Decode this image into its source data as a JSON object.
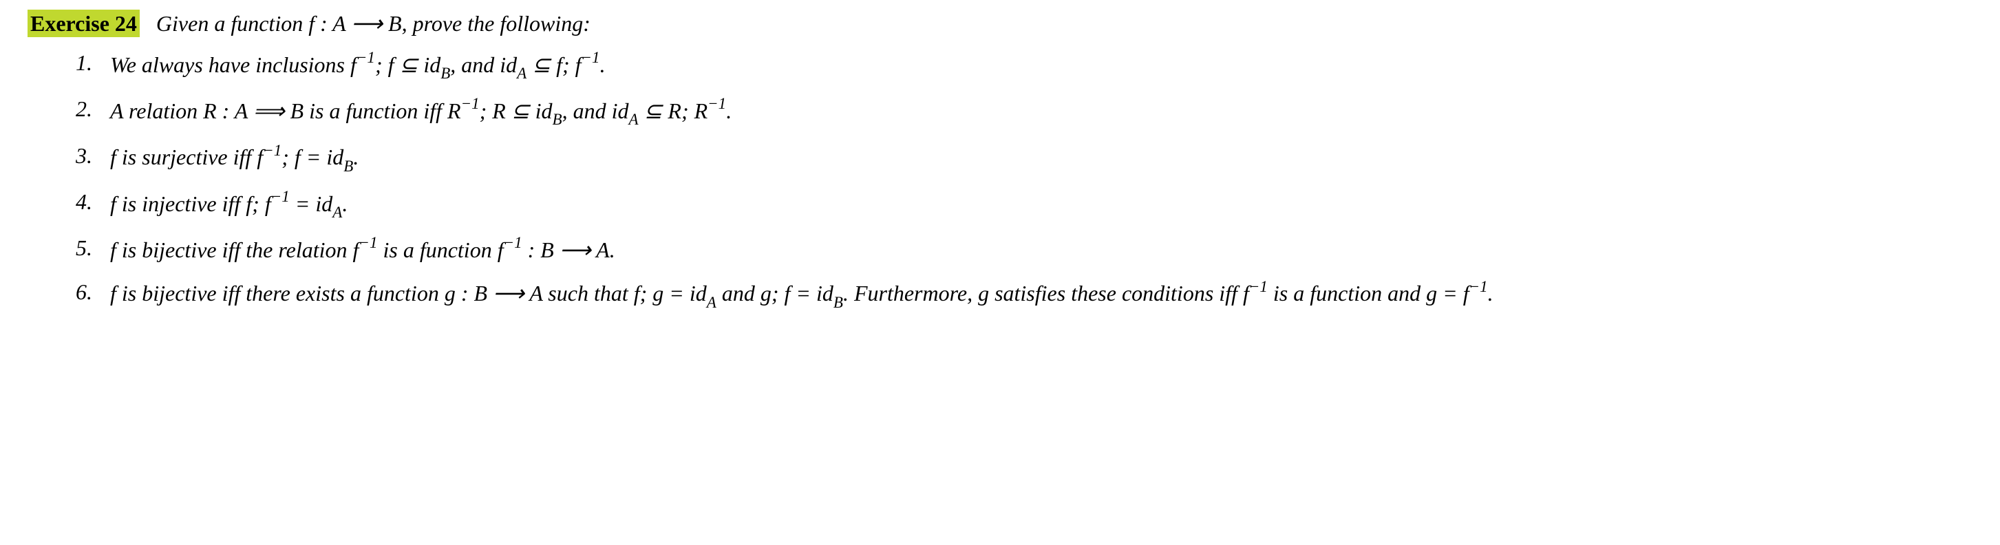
{
  "exercise": {
    "label": "Exercise 24",
    "intro": "Given a function f : A ⟶ B, prove the following:"
  },
  "items": [
    {
      "num": "1.",
      "html": "We always have inclusions f<span class='sup'>&minus;1</span>; f ⊆ id<span class='sub'>B</span>, and id<span class='sub'>A</span> ⊆ f; f<span class='sup'>&minus;1</span>."
    },
    {
      "num": "2.",
      "html": "A relation R : A ⟹ B is a function iff R<span class='sup'>&minus;1</span>; R ⊆ id<span class='sub'>B</span>, and id<span class='sub'>A</span> ⊆ R; R<span class='sup'>&minus;1</span>."
    },
    {
      "num": "3.",
      "html": "f is surjective iff f<span class='sup'>&minus;1</span>; f = id<span class='sub'>B</span>."
    },
    {
      "num": "4.",
      "html": "f is injective iff f; f<span class='sup'>&minus;1</span> = id<span class='sub'>A</span>."
    },
    {
      "num": "5.",
      "html": "f is bijective iff the relation f<span class='sup'>&minus;1</span> is a function f<span class='sup'>&minus;1</span> : B ⟶ A."
    },
    {
      "num": "6.",
      "html": "f is bijective iff there exists a function g : B ⟶ A such that f; g = id<span class='sub'>A</span> and g; f = id<span class='sub'>B</span>. Furthermore, g satisfies these conditions iff f<span class='sup'>&minus;1</span> is a function and g = f<span class='sup'>&minus;1</span>."
    }
  ]
}
